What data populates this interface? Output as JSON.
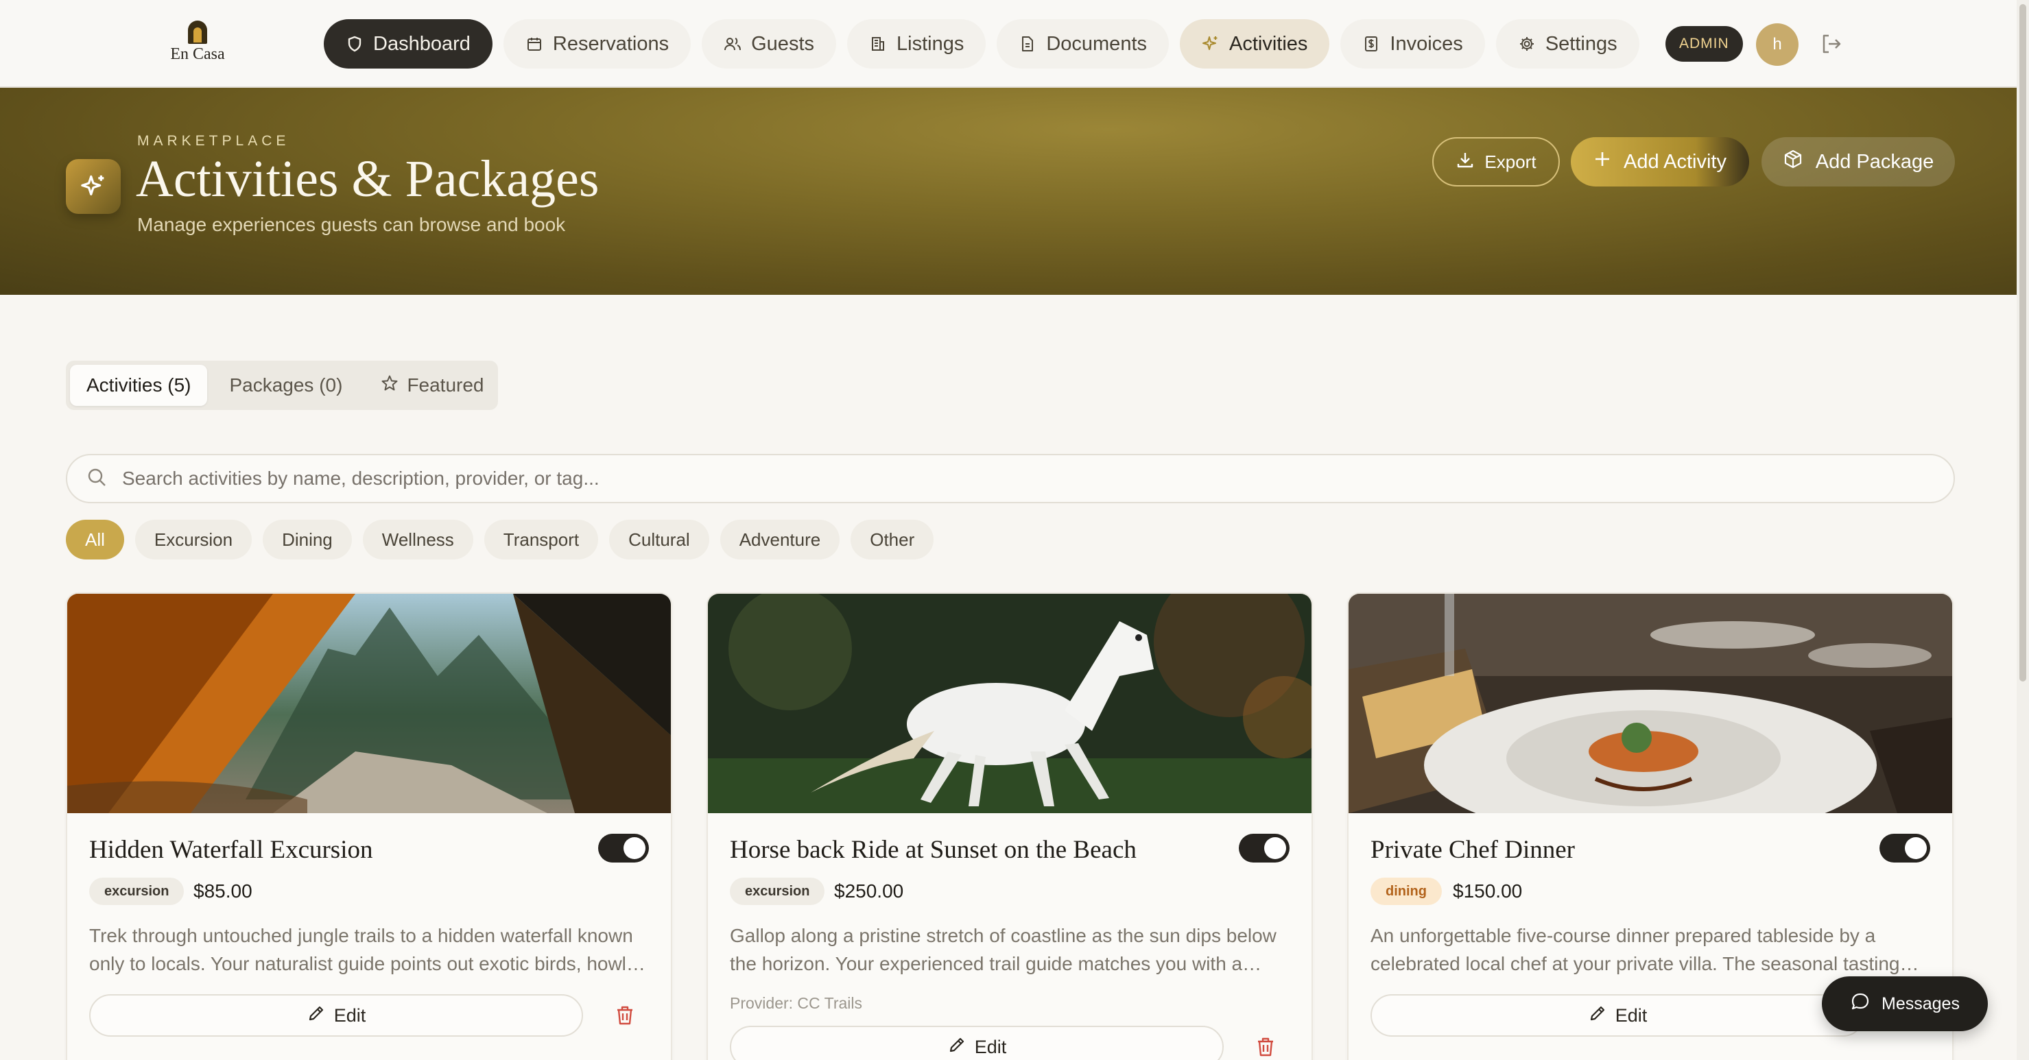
{
  "brand": {
    "name": "En Casa"
  },
  "nav": {
    "items": [
      {
        "label": "Dashboard",
        "icon": "shield-icon"
      },
      {
        "label": "Reservations",
        "icon": "calendar-icon"
      },
      {
        "label": "Guests",
        "icon": "users-icon"
      },
      {
        "label": "Listings",
        "icon": "building-icon"
      },
      {
        "label": "Documents",
        "icon": "document-icon"
      },
      {
        "label": "Activities",
        "icon": "sparkles-icon"
      },
      {
        "label": "Invoices",
        "icon": "invoice-icon"
      },
      {
        "label": "Settings",
        "icon": "gear-icon"
      }
    ],
    "active": "Activities"
  },
  "user": {
    "role_badge": "ADMIN",
    "avatar_initial": "h"
  },
  "hero": {
    "eyebrow": "MARKETPLACE",
    "title": "Activities & Packages",
    "subtitle": "Manage experiences guests can browse and book",
    "export_label": "Export",
    "add_activity_label": "Add Activity",
    "add_package_label": "Add Package"
  },
  "tabs": [
    {
      "label": "Activities (5)",
      "selected": true
    },
    {
      "label": "Packages (0)",
      "selected": false
    },
    {
      "label": "Featured",
      "selected": false
    }
  ],
  "search": {
    "placeholder": "Search activities by name, description, provider, or tag..."
  },
  "filters": [
    "All",
    "Excursion",
    "Dining",
    "Wellness",
    "Transport",
    "Cultural",
    "Adventure",
    "Other"
  ],
  "cards": [
    {
      "title": "Hidden Waterfall Excursion",
      "category": "excursion",
      "price": "$85.00",
      "description": "Trek through untouched jungle trails to a hidden waterfall known only to locals. Your naturalist guide points out exotic birds, howler monkeys and more.",
      "provider": "",
      "edit_label": "Edit",
      "enabled": true
    },
    {
      "title": "Horse back Ride at Sunset on the Beach",
      "category": "excursion",
      "price": "$250.00",
      "description": "Gallop along a pristine stretch of coastline as the sun dips below the horizon. Your experienced trail guide matches you with a horse suited to your level.",
      "provider": "Provider: CC Trails",
      "edit_label": "Edit",
      "enabled": true
    },
    {
      "title": "Private Chef Dinner",
      "category": "dining",
      "price": "$150.00",
      "description": "An unforgettable five-course dinner prepared tableside by a celebrated local chef at your private villa. The seasonal tasting menu showcases local ingredients.",
      "provider": "",
      "edit_label": "Edit",
      "enabled": true
    }
  ],
  "messages": {
    "label": "Messages"
  },
  "colors": {
    "accent_gold": "#c9a84c",
    "hero_olive": "#6f5f22",
    "dark": "#2f2c27",
    "dining_badge": "#fbe8cd"
  }
}
